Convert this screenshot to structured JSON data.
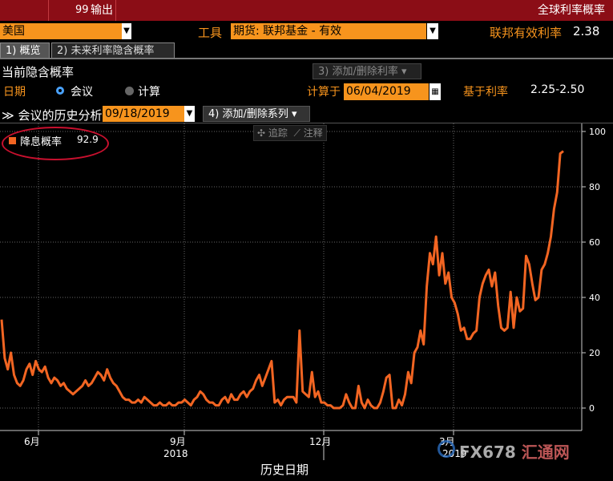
{
  "title_bar": {
    "menu_num": "99",
    "menu_label": "输出",
    "right_title": "全球利率概率"
  },
  "top_row": {
    "country": "美国",
    "tool_label": "工具",
    "tool_value": "期货: 联邦基金 - 有效",
    "rate_label": "联邦有效利率",
    "rate_value": "2.38"
  },
  "tabs": [
    {
      "label": "1) 概览"
    },
    {
      "label": "2) 未来利率隐含概率"
    }
  ],
  "current": {
    "title": "当前隐含概率",
    "add_button": "3) 添加/删除利率 ▾"
  },
  "date_row": {
    "date_label": "日期",
    "radio_meeting": "会议",
    "radio_calc": "计算",
    "calc_at_label": "计算于",
    "calc_at_value": "06/04/2019",
    "base_label": "基于利率",
    "base_value": "2.25-2.50"
  },
  "history": {
    "label": "≫ 会议的历史分析",
    "date": "09/18/2019",
    "add_series_button": "4) 添加/删除系列 ▾"
  },
  "chart_tools": {
    "track": "✣ 追踪",
    "annotate": "⟋ 注释"
  },
  "colors": {
    "series": "#f26522",
    "title_bar": "#8b0d16",
    "field": "#f7941d"
  },
  "chart_data": {
    "type": "line",
    "xlabel": "历史日期",
    "x_ticks": [
      "6月",
      "9月",
      "12月",
      "3月"
    ],
    "x_year_labels": [
      "2018",
      "2019"
    ],
    "y_ticks": [
      "100",
      "80",
      "60",
      "40",
      "20",
      "0"
    ],
    "ylim": [
      0,
      100
    ],
    "grid": true,
    "legend": "top-left",
    "series": [
      {
        "name": "降息概率",
        "last_value": "92.9",
        "values": [
          32,
          18,
          14,
          20,
          12,
          9,
          8,
          10,
          14,
          16,
          12,
          17,
          14,
          13,
          15,
          11,
          9,
          11,
          10,
          8,
          9,
          7,
          6,
          5,
          6,
          7,
          8,
          10,
          8,
          9,
          11,
          13,
          12,
          10,
          14,
          11,
          9,
          8,
          6,
          4,
          3,
          3,
          2,
          2,
          3,
          2,
          4,
          3,
          2,
          1,
          1,
          2,
          1,
          1,
          2,
          1,
          1,
          2,
          2,
          3,
          2,
          1,
          3,
          4,
          6,
          5,
          3,
          2,
          2,
          1,
          1,
          3,
          4,
          2,
          5,
          3,
          3,
          5,
          6,
          4,
          6,
          7,
          10,
          12,
          8,
          11,
          14,
          17,
          2,
          3,
          1,
          3,
          4,
          4,
          4,
          2,
          28,
          6,
          5,
          4,
          13,
          4,
          6,
          2,
          2,
          1,
          1,
          0,
          0,
          0,
          1,
          5,
          2,
          0,
          0,
          8,
          2,
          0,
          3,
          1,
          0,
          0,
          2,
          6,
          11,
          12,
          0,
          0,
          3,
          1,
          5,
          13,
          9,
          20,
          22,
          28,
          23,
          44,
          56,
          52,
          62,
          48,
          56,
          45,
          49,
          40,
          38,
          34,
          28,
          29,
          25,
          25,
          27,
          28,
          40,
          45,
          48,
          50,
          44,
          49,
          37,
          29,
          28,
          29,
          42,
          29,
          40,
          35,
          36,
          55,
          52,
          45,
          39,
          40,
          50,
          52,
          56,
          62,
          72,
          78,
          92,
          92.9
        ]
      }
    ]
  }
}
